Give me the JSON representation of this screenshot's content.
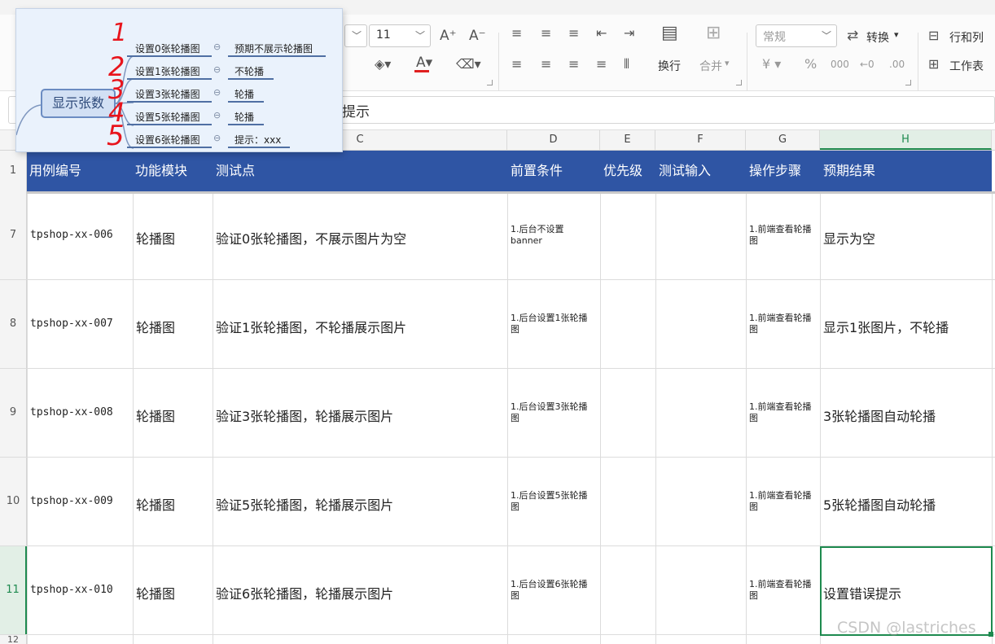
{
  "ribbon": {
    "font_size": "11",
    "number_format": "常规",
    "convert_label": "转换",
    "wrap_label": "换行",
    "merge_label": "合并",
    "row_col_label": "行和列",
    "sheet_label": "工作表",
    "font_color": "#e02020"
  },
  "formula_bar": {
    "text": "提示"
  },
  "columns": [
    "C",
    "D",
    "E",
    "F",
    "G",
    "H"
  ],
  "header_row": {
    "row_num": "1",
    "cells": [
      "用例编号",
      "功能模块",
      "测试点",
      "前置条件",
      "优先级",
      "测试输入",
      "操作步骤",
      "预期结果"
    ],
    "bg_color": "#2f55a4"
  },
  "rows": [
    {
      "num": "7",
      "id": "tpshop-xx-006",
      "module": "轮播图",
      "point": "验证0张轮播图，不展示图片为空",
      "precondition": "1.后台不设置banner",
      "steps": "1.前端查看轮播图",
      "expected": "显示为空"
    },
    {
      "num": "8",
      "id": "tpshop-xx-007",
      "module": "轮播图",
      "point": "验证1张轮播图，不轮播展示图片",
      "precondition": "1.后台设置1张轮播图",
      "steps": "1.前端查看轮播图",
      "expected": "显示1张图片，不轮播"
    },
    {
      "num": "9",
      "id": "tpshop-xx-008",
      "module": "轮播图",
      "point": "验证3张轮播图，轮播展示图片",
      "precondition": "1.后台设置3张轮播图",
      "steps": "1.前端查看轮播图",
      "expected": "3张轮播图自动轮播"
    },
    {
      "num": "10",
      "id": "tpshop-xx-009",
      "module": "轮播图",
      "point": "验证5张轮播图，轮播展示图片",
      "precondition": "1.后台设置5张轮播图",
      "steps": "1.前端查看轮播图",
      "expected": "5张轮播图自动轮播"
    },
    {
      "num": "11",
      "id": "tpshop-xx-010",
      "module": "轮播图",
      "point": "验证6张轮播图，轮播展示图片",
      "precondition": "1.后台设置6张轮播图",
      "steps": "1.前端查看轮播图",
      "expected": "设置错误提示"
    }
  ],
  "next_row_num": "12",
  "mindmap": {
    "center": "显示张数",
    "branches": [
      {
        "marker": "1",
        "label": "设置0张轮播图",
        "result": "预期不展示轮播图"
      },
      {
        "marker": "2",
        "label": "设置1张轮播图",
        "result": "不轮播"
      },
      {
        "marker": "3",
        "label": "设置3张轮播图",
        "result": "轮播"
      },
      {
        "marker": "4",
        "label": "设置5张轮播图",
        "result": "轮播"
      },
      {
        "marker": "5",
        "label": "设置6张轮播图",
        "result": "提示：xxx"
      }
    ],
    "marker_color": "#e8141c"
  },
  "watermark": "CSDN @lastriches"
}
